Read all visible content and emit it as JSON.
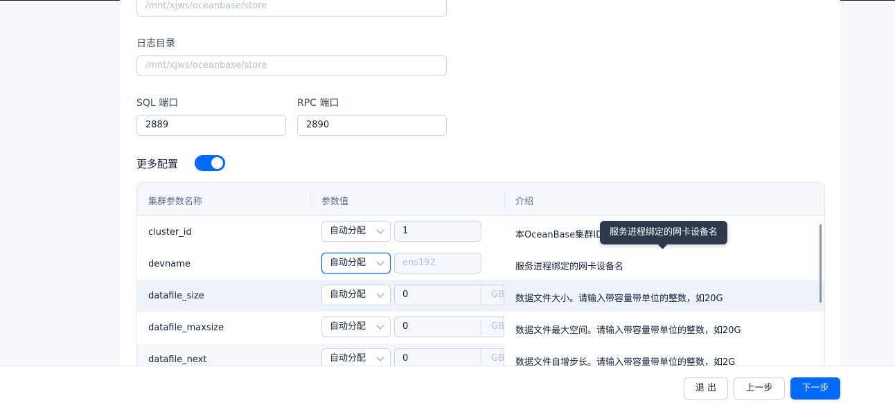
{
  "form": {
    "data_dir_placeholder": "/mnt/xjws/oceanbase/store",
    "log_dir_label": "日志目录",
    "log_dir_placeholder": "/mnt/xjws/oceanbase/store",
    "sql_port_label": "SQL 端口",
    "sql_port_value": "2889",
    "rpc_port_label": "RPC 端口",
    "rpc_port_value": "2890",
    "more_config_label": "更多配置",
    "more_config_enabled": true
  },
  "table": {
    "headers": [
      "集群参数名称",
      "参数值",
      "介绍"
    ],
    "rows": [
      {
        "name": "cluster_id",
        "mode": "自动分配",
        "value": "1",
        "unit": "",
        "desc": "本OceanBase集群ID"
      },
      {
        "name": "devname",
        "mode": "自动分配",
        "value": "ens192",
        "unit": "",
        "desc": "服务进程绑定的网卡设备名"
      },
      {
        "name": "datafile_size",
        "mode": "自动分配",
        "value": "0",
        "unit": "GB",
        "desc": "数据文件大小。请输入带容量带单位的整数，如20G"
      },
      {
        "name": "datafile_maxsize",
        "mode": "自动分配",
        "value": "0",
        "unit": "GB",
        "desc": "数据文件最大空间。请输入带容量带单位的整数，如20G"
      },
      {
        "name": "datafile_next",
        "mode": "自动分配",
        "value": "0",
        "unit": "GB",
        "desc": "数据文件自增步长。请输入带容量带单位的整数，如2G"
      }
    ]
  },
  "tooltip": {
    "text": "服务进程绑定的网卡设备名"
  },
  "footer": {
    "exit_label": "退 出",
    "prev_label": "上一步",
    "next_label": "下一步"
  },
  "colors": {
    "primary": "#006aff",
    "tooltip_bg": "#2f3a4d"
  }
}
